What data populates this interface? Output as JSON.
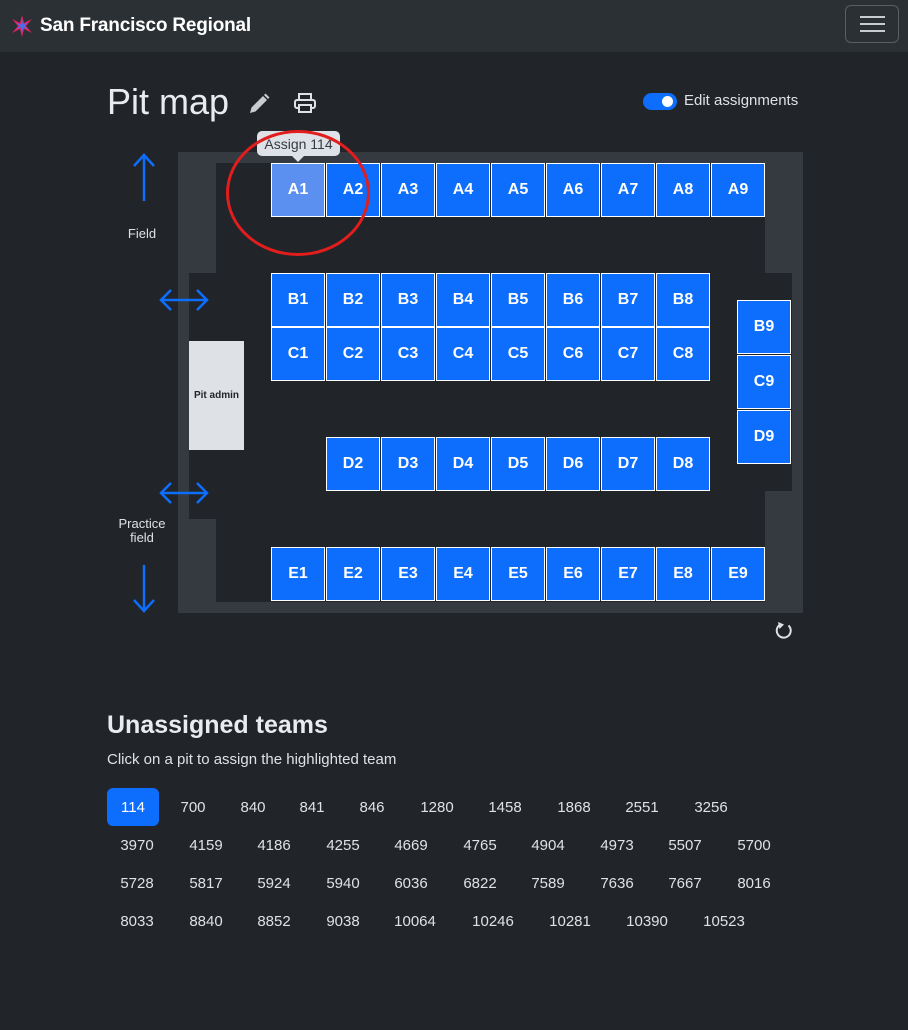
{
  "brand": {
    "name": "San Francisco Regional"
  },
  "page": {
    "title": "Pit map"
  },
  "controls": {
    "edit_assignments_label": "Edit assignments",
    "edit_assignments_on": true
  },
  "tooltip": {
    "text": "Assign 114"
  },
  "map": {
    "rows": {
      "A": [
        "A1",
        "A2",
        "A3",
        "A4",
        "A5",
        "A6",
        "A7",
        "A8",
        "A9"
      ],
      "B": [
        "B1",
        "B2",
        "B3",
        "B4",
        "B5",
        "B6",
        "B7",
        "B8"
      ],
      "C": [
        "C1",
        "C2",
        "C3",
        "C4",
        "C5",
        "C6",
        "C7",
        "C8"
      ],
      "D": [
        "D2",
        "D3",
        "D4",
        "D5",
        "D6",
        "D7",
        "D8"
      ],
      "E": [
        "E1",
        "E2",
        "E3",
        "E4",
        "E5",
        "E6",
        "E7",
        "E8",
        "E9"
      ],
      "side": [
        "B9",
        "C9",
        "D9"
      ]
    },
    "highlighted_pit": "A1",
    "pit_admin_label": "Pit admin",
    "field_label": "Field",
    "practice_field_label": "Practice field"
  },
  "unassigned": {
    "title": "Unassigned teams",
    "subtitle": "Click on a pit to assign the highlighted team",
    "selected": "114",
    "teams": [
      [
        "114",
        "700",
        "840",
        "841",
        "846",
        "1280",
        "1458",
        "1868",
        "2551",
        "3256"
      ],
      [
        "3970",
        "4159",
        "4186",
        "4255",
        "4669",
        "4765",
        "4904",
        "4973",
        "5507",
        "5700"
      ],
      [
        "5728",
        "5817",
        "5924",
        "5940",
        "6036",
        "6822",
        "7589",
        "7636",
        "7667",
        "8016"
      ],
      [
        "8033",
        "8840",
        "8852",
        "9038",
        "10064",
        "10246",
        "10281",
        "10390",
        "10523"
      ]
    ]
  },
  "colors": {
    "accent": "#0d6efd",
    "background": "#212529",
    "highlight_circle": "#e11d1d"
  }
}
